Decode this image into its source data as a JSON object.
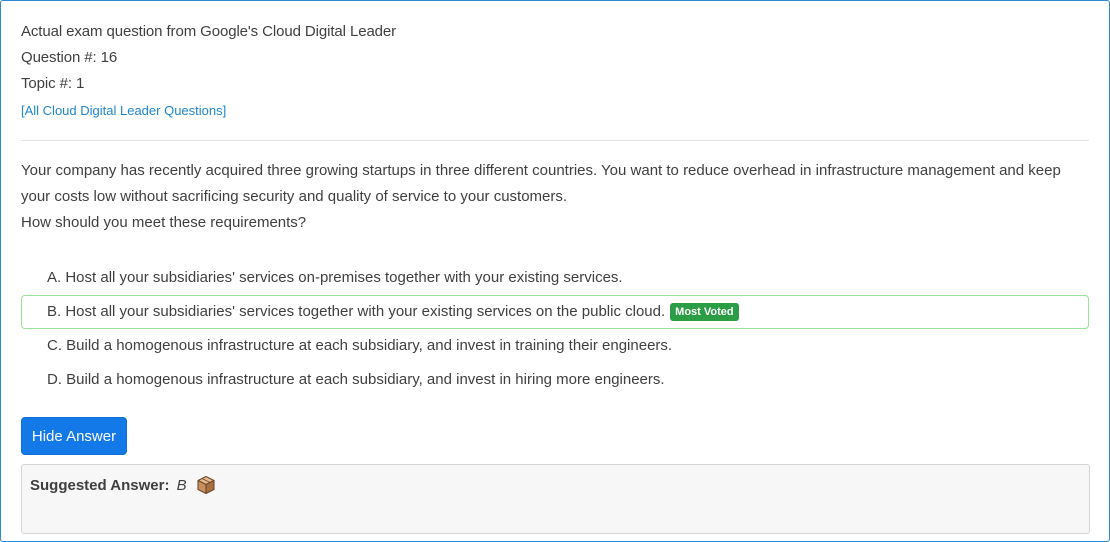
{
  "header": {
    "title": "Actual exam question from Google's Cloud Digital Leader",
    "question_number": "Question #: 16",
    "topic_number": "Topic #: 1",
    "all_questions_link": "[All Cloud Digital Leader Questions]"
  },
  "question": {
    "text": "Your company has recently acquired three growing startups in three different countries. You want to reduce overhead in infrastructure management and keep your costs low without sacrificing security and quality of service to your customers.",
    "prompt": "How should you meet these requirements?"
  },
  "choices": [
    {
      "label": "A. Host all your subsidiaries' services on-premises together with your existing services."
    },
    {
      "label": "B. Host all your subsidiaries' services together with your existing services on the public cloud.",
      "badge": "Most Voted"
    },
    {
      "label": "C. Build a homogenous infrastructure at each subsidiary, and invest in training their engineers."
    },
    {
      "label": "D. Build a homogenous infrastructure at each subsidiary, and invest in hiring more engineers."
    }
  ],
  "hide_answer_button": "Hide Answer",
  "suggested_answer": {
    "label": "Suggested Answer:",
    "value": "B",
    "icon": "box-icon"
  },
  "colors": {
    "link": "#1f86cf",
    "button": "#1479e8",
    "badge": "#2a9d45",
    "correct_border": "#9ae39a",
    "card_border": "#2b8ad0"
  }
}
